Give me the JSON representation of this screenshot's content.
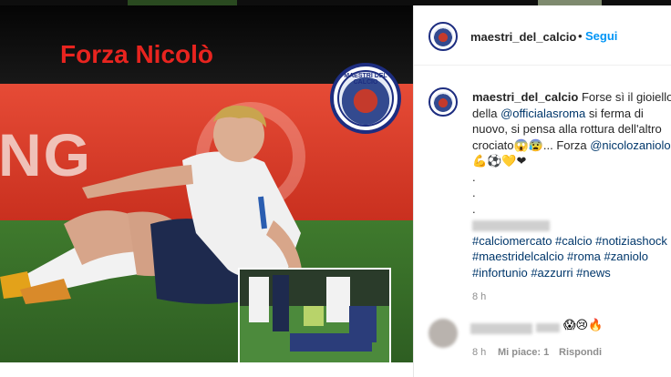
{
  "photo": {
    "caption": "Forza Nicolò",
    "logo_text": "MAESTRI DEL CALCIO",
    "board_text": "NG"
  },
  "header": {
    "username": "maestri_del_calcio",
    "separator": "•",
    "follow_label": "Segui"
  },
  "post": {
    "username": "maestri_del_calcio",
    "line1": "Forse sì il gioiello",
    "line2_pre": "della ",
    "line2_mention": "@officialasroma",
    "line2_post": " si ferma di",
    "line3": "nuovo, si pensa alla rottura dell'altro",
    "line4_pre": "crociato",
    "line4_emojis": "😱😰",
    "line4_mid": "... Forza ",
    "line4_mention": "@nicolozaniolo",
    "line5_emojis": "💪⚽💛❤",
    "dots": [
      ".",
      ".",
      "."
    ],
    "hashtags_line1": "#calciomercato #calcio #notiziashock",
    "hashtags_line2": "#maestridelcalcio #roma #zaniolo",
    "hashtags_line3": "#infortunio #azzurri #news",
    "time": "8 h"
  },
  "comment": {
    "emojis": "😱😢🔥",
    "time": "8 h",
    "likes": "Mi piace: 1",
    "reply": "Rispondi"
  },
  "colors": {
    "accent_blue": "#0095f6",
    "link": "#00376b",
    "caption_red": "#e8241f"
  }
}
